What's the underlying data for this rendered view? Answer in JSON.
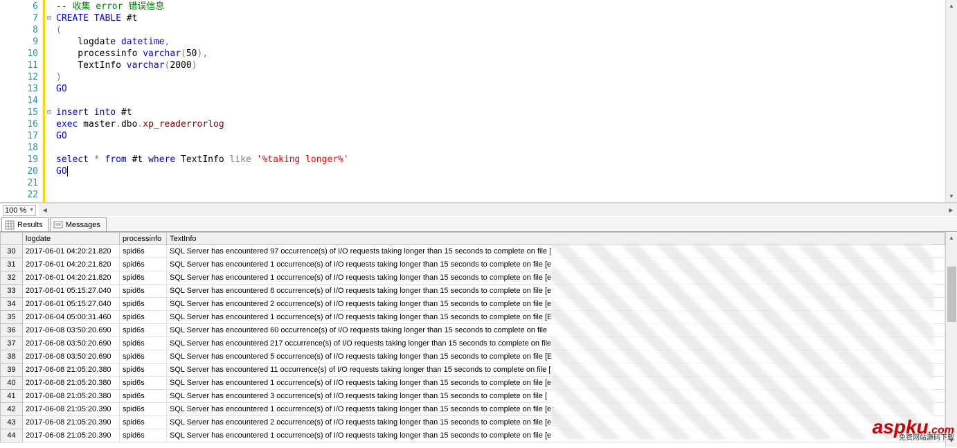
{
  "editor": {
    "line_start": 6,
    "line_end": 22,
    "zoom": "100 %",
    "lines": [
      {
        "n": 6,
        "fold": "",
        "html": "<span class='cm'>-- 收集 error 错误信息</span>"
      },
      {
        "n": 7,
        "fold": "⊟",
        "html": "<span class='kw'>CREATE</span> <span class='kw'>TABLE</span> #t"
      },
      {
        "n": 8,
        "fold": "",
        "html": "<span class='dot'>(</span>"
      },
      {
        "n": 9,
        "fold": "",
        "html": "    logdate <span class='tp'>datetime</span><span class='dot'>,</span>"
      },
      {
        "n": 10,
        "fold": "",
        "html": "    processinfo <span class='tp'>varchar</span><span class='dot'>(</span>50<span class='dot'>),</span>"
      },
      {
        "n": 11,
        "fold": "",
        "html": "    TextInfo <span class='tp'>varchar</span><span class='dot'>(</span>2000<span class='dot'>)</span>"
      },
      {
        "n": 12,
        "fold": "",
        "html": "<span class='dot'>)</span>"
      },
      {
        "n": 13,
        "fold": "",
        "html": "<span class='kw'>GO</span>"
      },
      {
        "n": 14,
        "fold": "",
        "html": ""
      },
      {
        "n": 15,
        "fold": "⊟",
        "html": "<span class='kw'>insert</span> <span class='kw'>into</span> #t"
      },
      {
        "n": 16,
        "fold": "",
        "html": "<span class='kw'>exec</span> master<span class='dot'>.</span>dbo<span class='dot'>.</span><span class='fn'>xp_readerrorlog</span>"
      },
      {
        "n": 17,
        "fold": "",
        "html": "<span class='kw'>GO</span>"
      },
      {
        "n": 18,
        "fold": "",
        "html": ""
      },
      {
        "n": 19,
        "fold": "",
        "html": "<span class='kw'>select</span> <span class='dot'>*</span> <span class='kw'>from</span> #t <span class='kw'>where</span> TextInfo <span class='dot'>like</span> <span class='str'>'%taking longer%'</span>"
      },
      {
        "n": 20,
        "fold": "",
        "html": "<span class='kw'>GO</span><span class='cursor'></span>"
      },
      {
        "n": 21,
        "fold": "",
        "html": ""
      },
      {
        "n": 22,
        "fold": "",
        "html": ""
      }
    ]
  },
  "tabs": {
    "results_label": "Results",
    "messages_label": "Messages"
  },
  "grid": {
    "columns": [
      "logdate",
      "processinfo",
      "TextInfo"
    ],
    "rows": [
      {
        "num": 30,
        "logdate": "2017-06-01 04:20:21.820",
        "processinfo": "spid6s",
        "text": "SQL Server has encountered 97 occurrence(s) of I/O requests taking longer than 15 seconds to complete on file ["
      },
      {
        "num": 31,
        "logdate": "2017-06-01 04:20:21.820",
        "processinfo": "spid6s",
        "text": "SQL Server has encountered 1 occurrence(s) of I/O requests taking longer than 15 seconds to complete on file [e"
      },
      {
        "num": 32,
        "logdate": "2017-06-01 04:20:21.820",
        "processinfo": "spid6s",
        "text": "SQL Server has encountered 1 occurrence(s) of I/O requests taking longer than 15 seconds to complete on file [e"
      },
      {
        "num": 33,
        "logdate": "2017-06-01 05:15:27.040",
        "processinfo": "spid6s",
        "text": "SQL Server has encountered 6 occurrence(s) of I/O requests taking longer than 15 seconds to complete on file [e"
      },
      {
        "num": 34,
        "logdate": "2017-06-01 05:15:27.040",
        "processinfo": "spid6s",
        "text": "SQL Server has encountered 2 occurrence(s) of I/O requests taking longer than 15 seconds to complete on file [e"
      },
      {
        "num": 35,
        "logdate": "2017-06-04 05:00:31.460",
        "processinfo": "spid6s",
        "text": "SQL Server has encountered 1 occurrence(s) of I/O requests taking longer than 15 seconds to complete on file [E"
      },
      {
        "num": 36,
        "logdate": "2017-06-08 03:50:20.690",
        "processinfo": "spid6s",
        "text": "SQL Server has encountered 60 occurrence(s) of I/O requests taking longer than 15 seconds to complete on file"
      },
      {
        "num": 37,
        "logdate": "2017-06-08 03:50:20.690",
        "processinfo": "spid6s",
        "text": "SQL Server has encountered 217 occurrence(s) of I/O requests taking longer than 15 seconds to complete on file"
      },
      {
        "num": 38,
        "logdate": "2017-06-08 03:50:20.690",
        "processinfo": "spid6s",
        "text": "SQL Server has encountered 5 occurrence(s) of I/O requests taking longer than 15 seconds to complete on file [E"
      },
      {
        "num": 39,
        "logdate": "2017-06-08 21:05:20.380",
        "processinfo": "spid6s",
        "text": "SQL Server has encountered 11 occurrence(s) of I/O requests taking longer than 15 seconds to complete on file ["
      },
      {
        "num": 40,
        "logdate": "2017-06-08 21:05:20.380",
        "processinfo": "spid6s",
        "text": "SQL Server has encountered 1 occurrence(s) of I/O requests taking longer than 15 seconds to complete on file [e"
      },
      {
        "num": 41,
        "logdate": "2017-06-08 21:05:20.380",
        "processinfo": "spid6s",
        "text": "SQL Server has encountered 3 occurrence(s) of I/O requests taking longer than 15 seconds to complete on file ["
      },
      {
        "num": 42,
        "logdate": "2017-06-08 21:05:20.390",
        "processinfo": "spid6s",
        "text": "SQL Server has encountered 1 occurrence(s) of I/O requests taking longer than 15 seconds to complete on file [e:"
      },
      {
        "num": 43,
        "logdate": "2017-06-08 21:05:20.390",
        "processinfo": "spid6s",
        "text": "SQL Server has encountered 2 occurrence(s) of I/O requests taking longer than 15 seconds to complete on file [e"
      },
      {
        "num": 44,
        "logdate": "2017-06-08 21:05:20.390",
        "processinfo": "spid6s",
        "text": "SQL Server has encountered 1 occurrence(s) of I/O requests taking longer than 15 seconds to complete on file [e"
      }
    ]
  },
  "watermark": {
    "brand": "aspku",
    "tld": ".com",
    "sub": "免费网站源码下载"
  }
}
